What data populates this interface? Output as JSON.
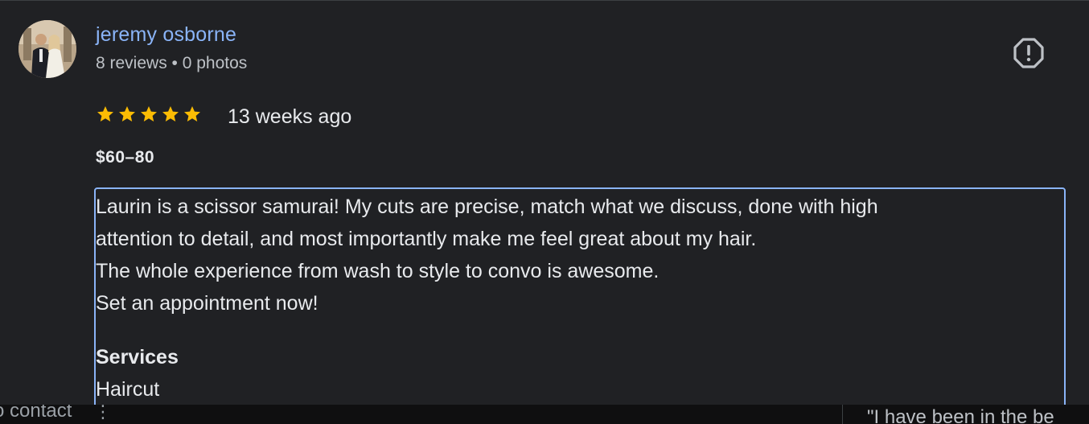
{
  "review": {
    "reviewer": {
      "name": "jeremy osborne",
      "meta": "8 reviews • 0 photos"
    },
    "rating": 5,
    "rating_icon": "star-icon",
    "time_ago": "13 weeks ago",
    "price_range": "$60–80",
    "text_lines": [
      "Laurin is a scissor samurai! My cuts are precise, match what we discuss, done with high",
      "attention to detail, and most importantly make me feel great about my hair.",
      "The whole experience from wash to style to convo is awesome.",
      "Set an appointment now!"
    ],
    "services": {
      "heading": "Services",
      "value": "Haircut"
    },
    "report_icon": "report-icon"
  },
  "background": {
    "left_text": "o contact",
    "more_icon": "more-vert-icon",
    "right_text": "\"I have been in the be"
  },
  "colors": {
    "background": "#202124",
    "name_link": "#8ab4f8",
    "star": "#fbbc04",
    "text": "#e8eaed",
    "secondary_text": "#bdc1c6",
    "focus_border": "#8ab4f8"
  }
}
